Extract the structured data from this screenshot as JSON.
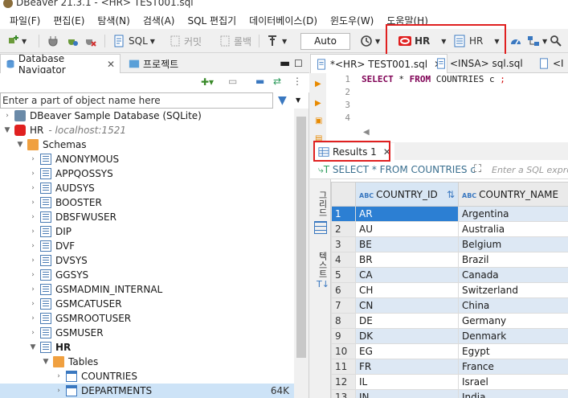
{
  "window": {
    "title": "DBeaver 21.3.1 - <HR> TEST001.sql"
  },
  "menu": [
    "파일(F)",
    "편집(E)",
    "탐색(N)",
    "검색(A)",
    "SQL 편집기",
    "데이터베이스(D)",
    "윈도우(W)",
    "도움말(H)"
  ],
  "toolbar": {
    "sql_label": "SQL",
    "commit_label": "커밋",
    "rollback_label": "롤백",
    "mode_value": "Auto",
    "datasource_label": "HR",
    "schema_label": "HR",
    "highlight_color": "#e02020"
  },
  "left": {
    "tabs": [
      {
        "label": "Database Navigator"
      },
      {
        "label": "프로젝트"
      }
    ],
    "filter_placeholder": "Enter a part of object name here",
    "tree": [
      {
        "label": "DBeaver Sample Database (SQLite)",
        "level": 0,
        "icon": "sqlite-icon"
      },
      {
        "label": "HR",
        "detail": "- localhost:1521",
        "level": 0,
        "icon": "oracle-icon"
      },
      {
        "label": "Schemas",
        "level": 1,
        "icon": "folder-icon"
      },
      {
        "label": "ANONYMOUS",
        "level": 2,
        "icon": "schema-icon"
      },
      {
        "label": "APPQOSSYS",
        "level": 2,
        "icon": "schema-icon"
      },
      {
        "label": "AUDSYS",
        "level": 2,
        "icon": "schema-icon"
      },
      {
        "label": "BOOSTER",
        "level": 2,
        "icon": "schema-icon"
      },
      {
        "label": "DBSFWUSER",
        "level": 2,
        "icon": "schema-icon"
      },
      {
        "label": "DIP",
        "level": 2,
        "icon": "schema-icon"
      },
      {
        "label": "DVF",
        "level": 2,
        "icon": "schema-icon"
      },
      {
        "label": "DVSYS",
        "level": 2,
        "icon": "schema-icon"
      },
      {
        "label": "GGSYS",
        "level": 2,
        "icon": "schema-icon"
      },
      {
        "label": "GSMADMIN_INTERNAL",
        "level": 2,
        "icon": "schema-icon"
      },
      {
        "label": "GSMCATUSER",
        "level": 2,
        "icon": "schema-icon"
      },
      {
        "label": "GSMROOTUSER",
        "level": 2,
        "icon": "schema-icon"
      },
      {
        "label": "GSMUSER",
        "level": 2,
        "icon": "schema-icon"
      },
      {
        "label": "HR",
        "level": 2,
        "icon": "schema-icon",
        "bold": true
      },
      {
        "label": "Tables",
        "level": 3,
        "icon": "folder-icon"
      },
      {
        "label": "COUNTRIES",
        "level": 4,
        "icon": "table-icon"
      },
      {
        "label": "DEPARTMENTS",
        "level": 4,
        "icon": "table-icon",
        "size": "64K"
      }
    ]
  },
  "editor": {
    "tabs": [
      {
        "label": "*<HR> TEST001.sql"
      },
      {
        "label": "<INSA> sql.sql"
      },
      {
        "label": "<I"
      }
    ],
    "line_numbers": [
      "1",
      "2",
      "3",
      "4"
    ],
    "code_kw1": "SELECT",
    "code_star": "*",
    "code_kw2": "FROM",
    "code_table": "COUNTRIES c",
    "code_semicolon": ";"
  },
  "results": {
    "tab_label": "Results 1",
    "query_text": "SELECT * FROM COUNTRIES c",
    "filter_placeholder": "Enter a SQL expre",
    "side_labels": {
      "grid": "그리드",
      "text": "텍스트"
    },
    "columns": [
      {
        "type": "ABC",
        "name": "COUNTRY_ID"
      },
      {
        "type": "ABC",
        "name": "COUNTRY_NAME"
      }
    ],
    "rows": [
      {
        "n": "1",
        "id": "AR",
        "name": "Argentina"
      },
      {
        "n": "2",
        "id": "AU",
        "name": "Australia"
      },
      {
        "n": "3",
        "id": "BE",
        "name": "Belgium"
      },
      {
        "n": "4",
        "id": "BR",
        "name": "Brazil"
      },
      {
        "n": "5",
        "id": "CA",
        "name": "Canada"
      },
      {
        "n": "6",
        "id": "CH",
        "name": "Switzerland"
      },
      {
        "n": "7",
        "id": "CN",
        "name": "China"
      },
      {
        "n": "8",
        "id": "DE",
        "name": "Germany"
      },
      {
        "n": "9",
        "id": "DK",
        "name": "Denmark"
      },
      {
        "n": "10",
        "id": "EG",
        "name": "Egypt"
      },
      {
        "n": "11",
        "id": "FR",
        "name": "France"
      },
      {
        "n": "12",
        "id": "IL",
        "name": "Israel"
      },
      {
        "n": "13",
        "id": "IN",
        "name": "India"
      }
    ]
  }
}
